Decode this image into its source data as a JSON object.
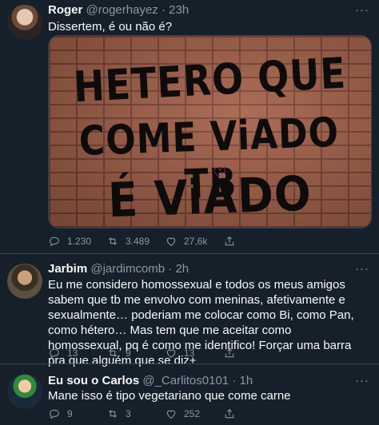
{
  "tweets": [
    {
      "name": "Roger",
      "handle": "@rogerhayez",
      "time": "23h",
      "text": "Dissertem, é ou não é?",
      "media_text": [
        "HETERO QUE",
        "COME ViADO TB",
        "É ViADO"
      ],
      "replies": "1.230",
      "retweets": "3.489",
      "likes": "27,6k"
    },
    {
      "name": "Jarbim",
      "handle": "@jardimcomb",
      "time": "2h",
      "text": "Eu me considero homossexual e todos os meus amigos sabem que tb me envolvo com meninas, afetivamente e sexualmente… poderiam me colocar como Bi, como Pan, como hétero… Mas tem que me aceitar como homossexual, pq é como me identifico! Forçar uma barra pra que alguém que se diz+",
      "replies": "13",
      "retweets": "9",
      "likes": "13"
    },
    {
      "name": "Eu sou o Carlos",
      "handle": "@_Carlitos0101",
      "time": "1h",
      "text": "Mane isso é tipo vegetariano que come carne",
      "replies": "9",
      "retweets": "3",
      "likes": "252"
    }
  ],
  "icons": {
    "reply": "reply-icon",
    "retweet": "retweet-icon",
    "like": "like-icon",
    "share": "share-icon",
    "more": "more-icon"
  },
  "colors": {
    "background": "#15202b",
    "text": "#f7f9f9",
    "secondary": "#8b98a5",
    "divider": "#38444d"
  }
}
